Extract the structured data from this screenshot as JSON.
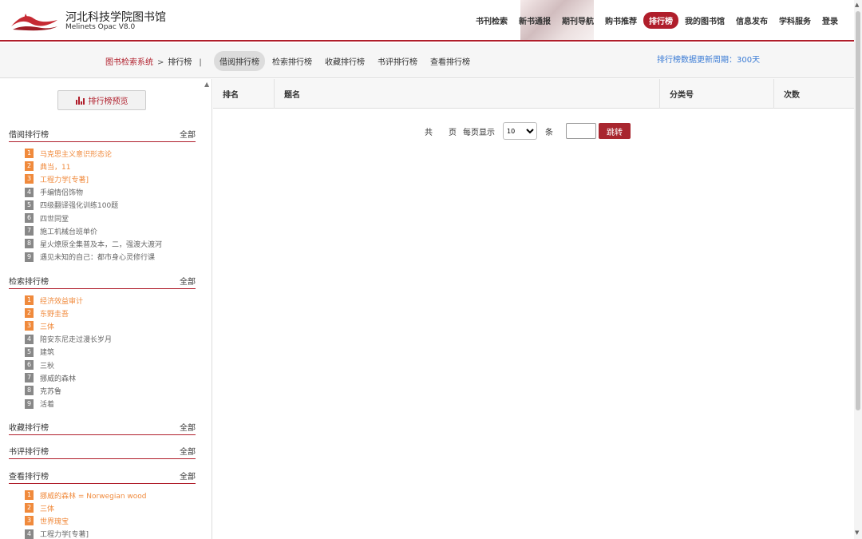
{
  "header": {
    "title": "河北科技学院图书馆",
    "subtitle": "Melinets Opac V8.0",
    "nav": [
      {
        "label": "书刊检索",
        "active": false
      },
      {
        "label": "新书通报",
        "active": false
      },
      {
        "label": "期刊导航",
        "active": false
      },
      {
        "label": "购书推荐",
        "active": false
      },
      {
        "label": "排行榜",
        "active": true
      },
      {
        "label": "我的图书馆",
        "active": false
      },
      {
        "label": "信息发布",
        "active": false
      },
      {
        "label": "学科服务",
        "active": false
      },
      {
        "label": "登录",
        "active": false
      }
    ]
  },
  "breadcrumb": {
    "root": "图书检索系统",
    "separator": ">",
    "current": "排行榜",
    "divider": "|"
  },
  "tabs": [
    {
      "label": "借阅排行榜",
      "active": true
    },
    {
      "label": "检索排行榜",
      "active": false
    },
    {
      "label": "收藏排行榜",
      "active": false
    },
    {
      "label": "书评排行榜",
      "active": false
    },
    {
      "label": "查看排行榜",
      "active": false
    }
  ],
  "period_text": "排行榜数据更新周期：300天",
  "sidebar": {
    "preview_button": "排行榜预览",
    "sections": [
      {
        "title": "借阅排行榜",
        "all": "全部",
        "items": [
          {
            "n": "1",
            "text": "马克思主义意识形态论"
          },
          {
            "n": "2",
            "text": "典当，11"
          },
          {
            "n": "3",
            "text": "工程力学[专著]"
          },
          {
            "n": "4",
            "text": "手编情侣饰物"
          },
          {
            "n": "5",
            "text": "四级翻译强化训练100题"
          },
          {
            "n": "6",
            "text": "四世同堂"
          },
          {
            "n": "7",
            "text": "施工机械台班单价"
          },
          {
            "n": "8",
            "text": "星火燎原全集普及本，二，强渡大渡河"
          },
          {
            "n": "9",
            "text": "遇见未知的自己：都市身心灵修行课"
          }
        ]
      },
      {
        "title": "检索排行榜",
        "all": "全部",
        "items": [
          {
            "n": "1",
            "text": "经济效益审计"
          },
          {
            "n": "2",
            "text": "东野圭吾"
          },
          {
            "n": "3",
            "text": "三体"
          },
          {
            "n": "4",
            "text": "陪安东尼走过漫长岁月"
          },
          {
            "n": "5",
            "text": "建筑"
          },
          {
            "n": "6",
            "text": "三秋"
          },
          {
            "n": "7",
            "text": "挪威的森林"
          },
          {
            "n": "8",
            "text": "克苏鲁"
          },
          {
            "n": "9",
            "text": "活着"
          }
        ]
      },
      {
        "title": "收藏排行榜",
        "all": "全部",
        "items": []
      },
      {
        "title": "书评排行榜",
        "all": "全部",
        "items": []
      },
      {
        "title": "查看排行榜",
        "all": "全部",
        "items": [
          {
            "n": "1",
            "text": "挪威的森林 = Norwegian wood"
          },
          {
            "n": "2",
            "text": "三体"
          },
          {
            "n": "3",
            "text": "世界瑰宝"
          },
          {
            "n": "4",
            "text": "工程力学[专著]"
          }
        ]
      }
    ]
  },
  "table": {
    "headers": {
      "rank": "排名",
      "title": "题名",
      "class": "分类号",
      "count": "次数"
    }
  },
  "pager": {
    "total_prefix": "共",
    "total_suffix": "页",
    "per_page_label": "每页显示",
    "per_page_value": "10",
    "unit": "条",
    "jump_button": "跳转"
  },
  "colors": {
    "brand": "#b01e2b",
    "top_rank": "#f08a3c",
    "link_blue": "#3a7bd5"
  }
}
